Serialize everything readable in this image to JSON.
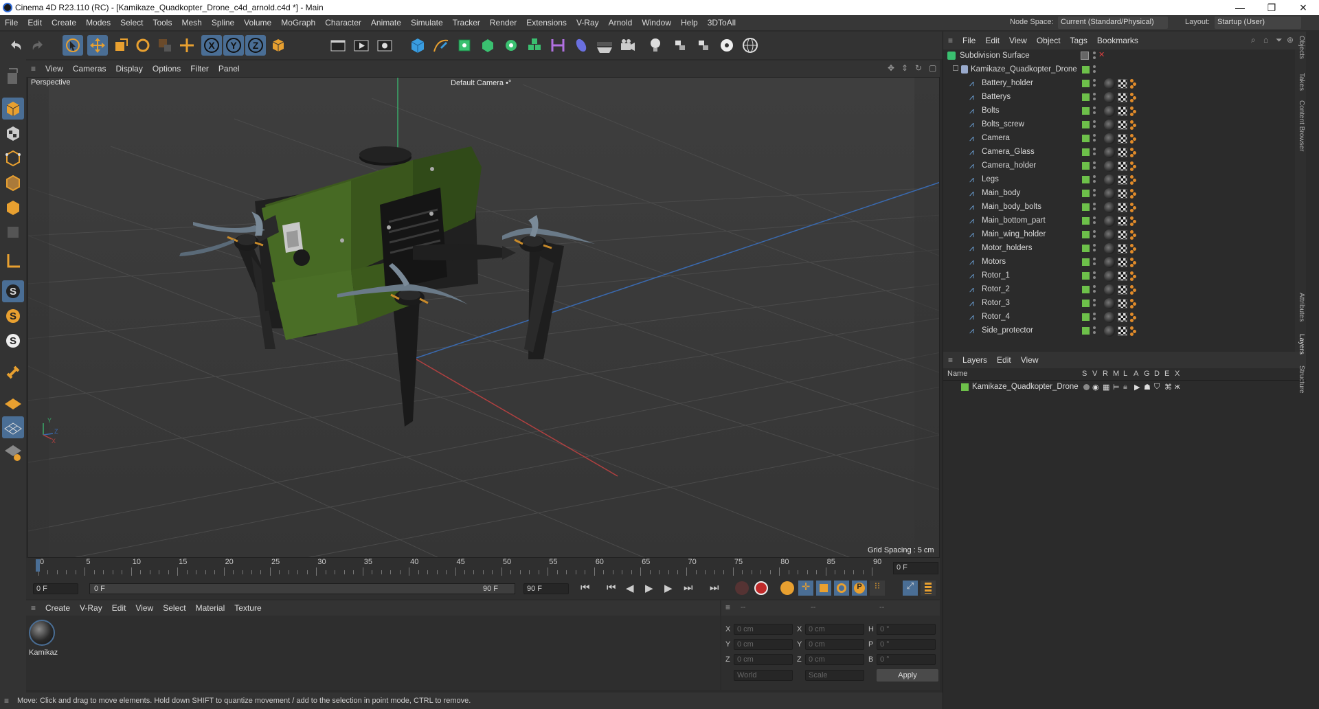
{
  "window": {
    "title": "Cinema 4D R23.110 (RC) - [Kamikaze_Quadkopter_Drone_c4d_arnold.c4d *] - Main",
    "minimize": "—",
    "maximize": "❐",
    "close": "✕"
  },
  "menubar": {
    "items": [
      "File",
      "Edit",
      "Create",
      "Modes",
      "Select",
      "Tools",
      "Mesh",
      "Spline",
      "Volume",
      "MoGraph",
      "Character",
      "Animate",
      "Simulate",
      "Tracker",
      "Render",
      "Extensions",
      "V-Ray",
      "Arnold",
      "Window",
      "Help",
      "3DToAll"
    ],
    "node_space_label": "Node Space:",
    "node_space_value": "Current (Standard/Physical)",
    "layout_label": "Layout:",
    "layout_value": "Startup (User)"
  },
  "viewport": {
    "menu": [
      "View",
      "Cameras",
      "Display",
      "Options",
      "Filter",
      "Panel"
    ],
    "name": "Perspective",
    "camera": "Default Camera",
    "camera_suffix": "•°",
    "grid_spacing": "Grid Spacing : 5 cm",
    "axis_y": "Y",
    "axis_z": "Z",
    "axis_x": "X"
  },
  "timeline": {
    "ticks": [
      "0",
      "5",
      "10",
      "15",
      "20",
      "25",
      "30",
      "35",
      "40",
      "45",
      "50",
      "55",
      "60",
      "65",
      "70",
      "75",
      "80",
      "85",
      "90"
    ],
    "current_frame_right": "0 F",
    "start_frame": "0 F",
    "range_start": "0 F",
    "range_end": "90 F",
    "end_frame": "90 F"
  },
  "material_panel": {
    "menu": [
      "Create",
      "V-Ray",
      "Edit",
      "View",
      "Select",
      "Material",
      "Texture"
    ],
    "material_name": "Kamikaz"
  },
  "coord_panel": {
    "header": [
      "--",
      "--",
      "--"
    ],
    "rows": [
      {
        "a": "X",
        "av": "0 cm",
        "b": "X",
        "bv": "0 cm",
        "c": "H",
        "cv": "0 °"
      },
      {
        "a": "Y",
        "av": "0 cm",
        "b": "Y",
        "bv": "0 cm",
        "c": "P",
        "cv": "0 °"
      },
      {
        "a": "Z",
        "av": "0 cm",
        "b": "Z",
        "bv": "0 cm",
        "c": "B",
        "cv": "0 °"
      }
    ],
    "world": "World",
    "scale": "Scale",
    "apply": "Apply"
  },
  "status": "Move: Click and drag to move elements. Hold down SHIFT to quantize movement / add to the selection in point mode, CTRL to remove.",
  "object_manager": {
    "menu": [
      "File",
      "Edit",
      "View",
      "Object",
      "Tags",
      "Bookmarks"
    ],
    "root": "Subdivision Surface",
    "group": "Kamikaze_Quadkopter_Drone",
    "children": [
      "Battery_holder",
      "Batterys",
      "Bolts",
      "Bolts_screw",
      "Camera",
      "Camera_Glass",
      "Camera_holder",
      "Legs",
      "Main_body",
      "Main_body_bolts",
      "Main_bottom_part",
      "Main_wing_holder",
      "Motor_holders",
      "Motors",
      "Rotor_1",
      "Rotor_2",
      "Rotor_3",
      "Rotor_4",
      "Side_protector"
    ]
  },
  "layer_manager": {
    "menu": [
      "Layers",
      "Edit",
      "View"
    ],
    "col_name": "Name",
    "col_flags": [
      "S",
      "V",
      "R",
      "M",
      "L",
      "A",
      "G",
      "D",
      "E",
      "X"
    ],
    "layer": "Kamikaze_Quadkopter_Drone"
  },
  "side_tabs": [
    "Objects",
    "Takes",
    "Content Browser",
    "Attributes",
    "Layers",
    "Structure"
  ],
  "colors": {
    "accent_blue": "#4a6e95",
    "green_check": "#6dc04a",
    "drone_green": "#3d5a1e"
  }
}
